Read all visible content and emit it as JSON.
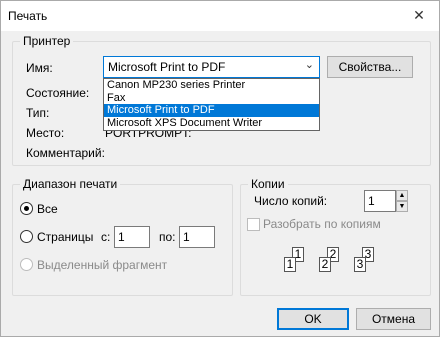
{
  "window": {
    "title": "Печать",
    "close_glyph": "✕"
  },
  "printer": {
    "legend": "Принтер",
    "name_label": "Имя:",
    "status_label": "Состояние:",
    "type_label": "Тип:",
    "where_label": "Место:",
    "comment_label": "Комментарий:",
    "where_value": "PORTPROMPT:",
    "selected": "Microsoft Print to PDF",
    "properties_button": "Свойства...",
    "options": [
      "Canon MP230 series Printer",
      "Fax",
      "Microsoft Print to PDF",
      "Microsoft XPS Document Writer"
    ]
  },
  "range": {
    "legend": "Диапазон печати",
    "all": "Все",
    "pages": "Страницы",
    "from_label": "с:",
    "from_value": "1",
    "to_label": "по:",
    "to_value": "1",
    "selection": "Выделенный фрагмент"
  },
  "copies": {
    "legend": "Копии",
    "count_label": "Число копий:",
    "count_value": "1",
    "collate_label": "Разобрать по копиям",
    "collate_icon": [
      "1",
      "1",
      "2",
      "2",
      "3",
      "3"
    ]
  },
  "buttons": {
    "ok": "OK",
    "cancel": "Отмена"
  },
  "colors": {
    "accent": "#0078d7",
    "selection_bg": "#0078d7"
  }
}
